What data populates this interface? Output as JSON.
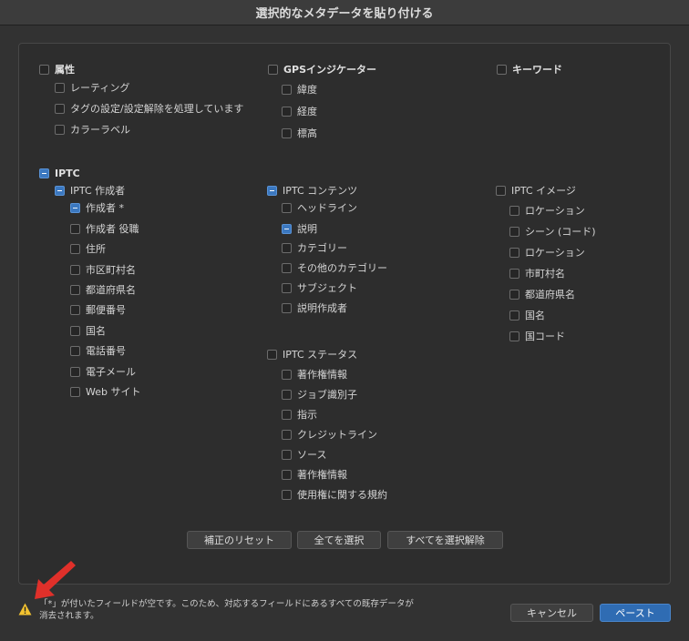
{
  "dialog": {
    "title": "選択的なメタデータを貼り付ける"
  },
  "sections": {
    "attributes": {
      "label": "属性",
      "items": [
        "レーティング",
        "タグの設定/設定解除を処理しています",
        "カラーラベル"
      ]
    },
    "gps": {
      "label": "GPSインジケーター",
      "items": [
        "緯度",
        "経度",
        "標高"
      ]
    },
    "keywords": {
      "label": "キーワード"
    },
    "iptc": {
      "label": "IPTC",
      "creator": {
        "label": "IPTC 作成者",
        "items": [
          "作成者 *",
          "作成者 役職",
          "住所",
          "市区町村名",
          "都道府県名",
          "郵便番号",
          "国名",
          "電話番号",
          "電子メール",
          "Web サイト"
        ]
      },
      "content": {
        "label": "IPTC コンテンツ",
        "items": [
          "ヘッドライン",
          "説明",
          "カテゴリー",
          "その他のカテゴリー",
          "サブジェクト",
          "説明作成者"
        ]
      },
      "status": {
        "label": "IPTC ステータス",
        "items": [
          "著作権情報",
          "ジョブ識別子",
          "指示",
          "クレジットライン",
          "ソース",
          "著作権情報",
          "使用権に関する規約"
        ]
      },
      "image": {
        "label": "IPTC イメージ",
        "items": [
          "ロケーション",
          "シーン (コード)",
          "ロケーション",
          "市町村名",
          "都道府県名",
          "国名",
          "国コード"
        ]
      }
    }
  },
  "buttons": {
    "reset": "補正のリセット",
    "select_all": "全てを選択",
    "deselect_all": "すべてを選択解除",
    "cancel": "キャンセル",
    "paste": "ペースト"
  },
  "warning": {
    "line1": "「*」が付いたフィールドが空です。このため、対応するフィールドにあるすべての既存データが",
    "line2": "消去されます。"
  },
  "colors": {
    "accent": "#3b78c0",
    "warning_icon": "#f2c230",
    "arrow": "#e0302a"
  }
}
